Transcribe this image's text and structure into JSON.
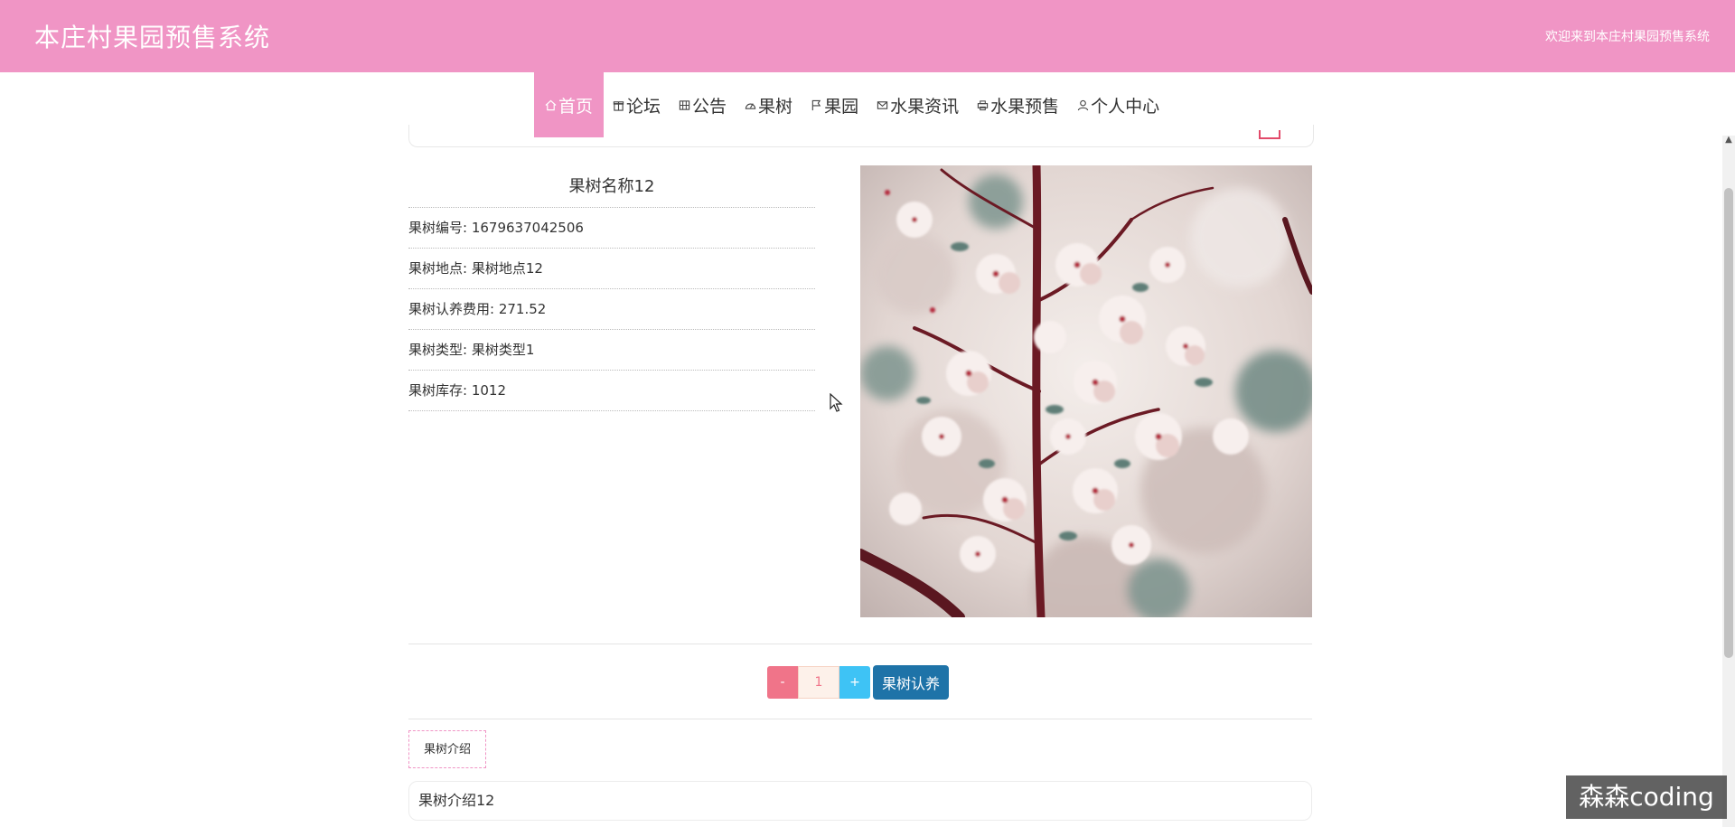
{
  "header": {
    "site_title": "本庄村果园预售系统",
    "welcome_text": "欢迎来到本庄村果园预售系统"
  },
  "nav": {
    "items": [
      {
        "label": "首页",
        "icon": "home-icon",
        "active": true
      },
      {
        "label": "论坛",
        "icon": "gift-icon"
      },
      {
        "label": "公告",
        "icon": "grid-icon"
      },
      {
        "label": "果树",
        "icon": "gauge-icon"
      },
      {
        "label": "果园",
        "icon": "flag-icon"
      },
      {
        "label": "水果资讯",
        "icon": "mail-icon"
      },
      {
        "label": "水果预售",
        "icon": "printer-icon"
      },
      {
        "label": "个人中心",
        "icon": "user-icon"
      }
    ]
  },
  "detail": {
    "title": "果树名称12",
    "fields": [
      {
        "label": "果树编号",
        "value": "1679637042506"
      },
      {
        "label": "果树地点",
        "value": "果树地点12"
      },
      {
        "label": "果树认养费用",
        "value": "271.52"
      },
      {
        "label": "果树类型",
        "value": "果树类型1"
      },
      {
        "label": "果树库存",
        "value": "1012"
      }
    ],
    "image_subject": "cherry-blossom-branch-photo"
  },
  "purchase": {
    "minus_label": "-",
    "quantity": "1",
    "plus_label": "+",
    "adopt_label": "果树认养"
  },
  "intro": {
    "tab_label": "果树介绍",
    "content": "果树介绍12"
  },
  "watermark": "森森coding",
  "colors": {
    "header_bg": "#f095c5",
    "active_nav_bg": "#f095c5",
    "minus_bg": "#f07489",
    "plus_bg": "#3ec3f5",
    "adopt_bg": "#1e73a8"
  }
}
